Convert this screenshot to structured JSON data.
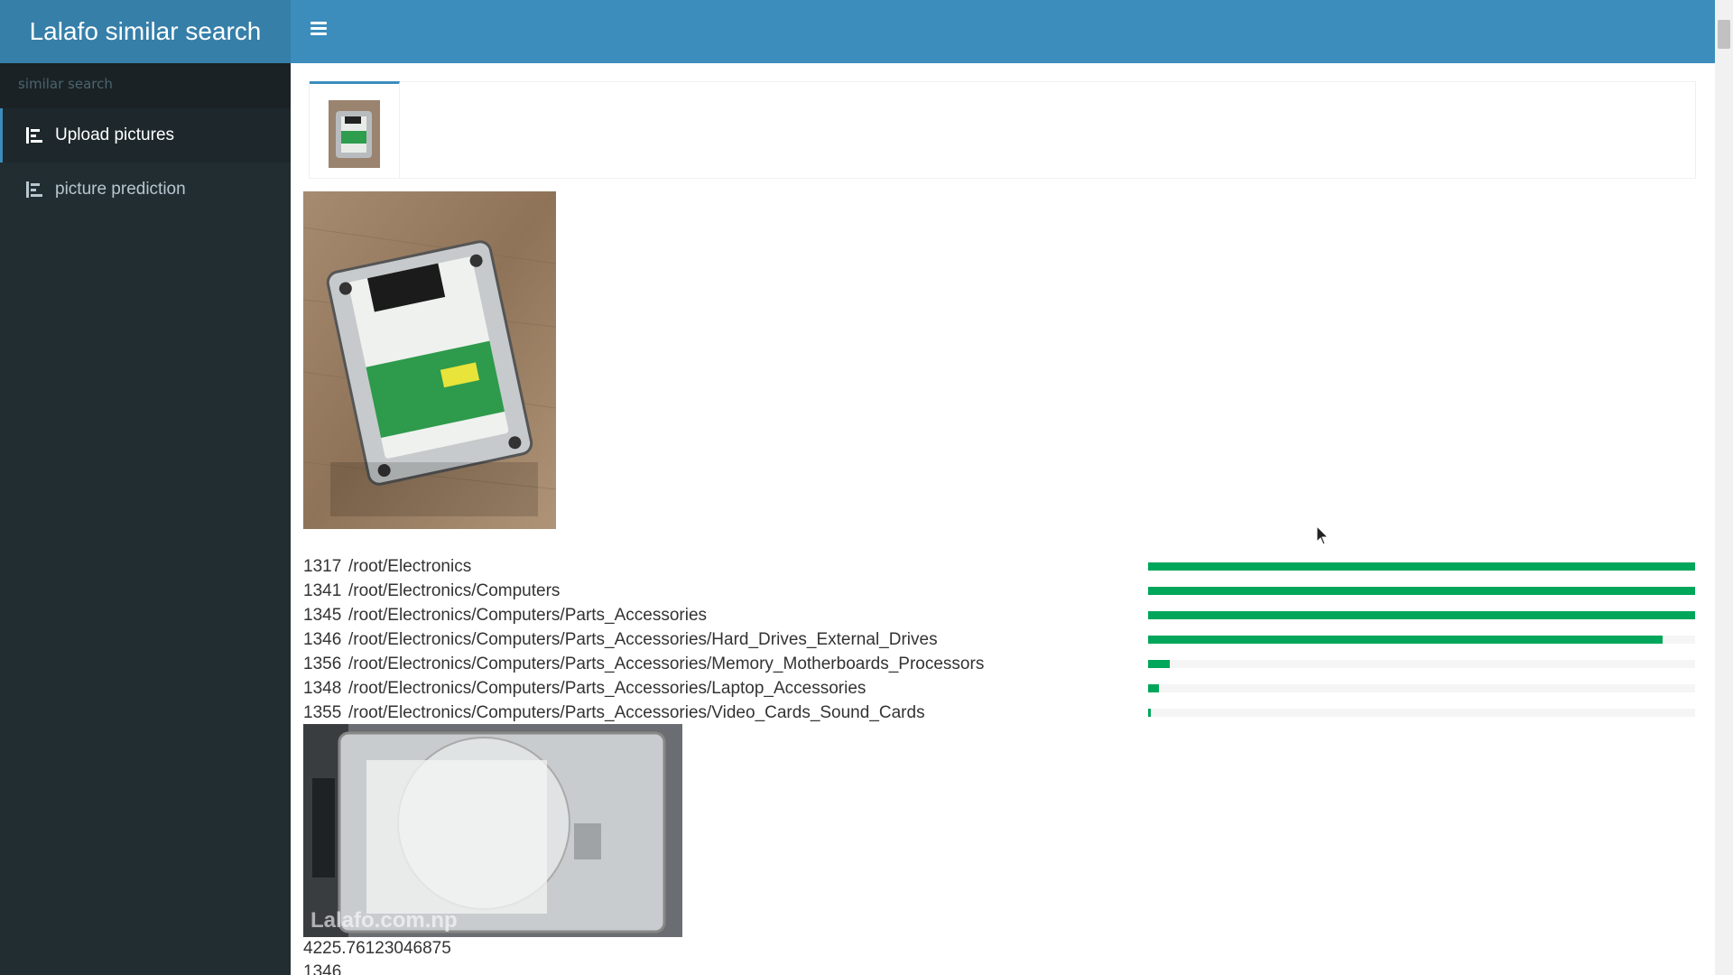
{
  "app": {
    "title": "Lalafo similar search"
  },
  "sidebar": {
    "header": "similar search",
    "items": [
      {
        "label": "Upload pictures",
        "icon": "bar-chart-icon",
        "active": true
      },
      {
        "label": "picture prediction",
        "icon": "bar-chart-icon",
        "active": false
      }
    ]
  },
  "colors": {
    "sidebar_bg": "#222d32",
    "header_bg": "#3c8dbc",
    "logo_bg": "#367fa9",
    "bar_green": "#00a65a"
  },
  "results": [
    {
      "id": "1317",
      "path": "/root/Electronics",
      "probability": 1.0
    },
    {
      "id": "1341",
      "path": "/root/Electronics/Computers",
      "probability": 1.0
    },
    {
      "id": "1345",
      "path": "/root/Electronics/Computers/Parts_Accessories",
      "probability": 1.0
    },
    {
      "id": "1346",
      "path": "/root/Electronics/Computers/Parts_Accessories/Hard_Drives_External_Drives",
      "probability": 0.94
    },
    {
      "id": "1356",
      "path": "/root/Electronics/Computers/Parts_Accessories/Memory_Motherboards_Processors",
      "probability": 0.04
    },
    {
      "id": "1348",
      "path": "/root/Electronics/Computers/Parts_Accessories/Laptop_Accessories",
      "probability": 0.02
    },
    {
      "id": "1355",
      "path": "/root/Electronics/Computers/Parts_Accessories/Video_Cards_Sound_Cards",
      "probability": 0.005
    }
  ],
  "similar": {
    "watermark": "Lalafo.com.np",
    "distance": "4225.76123046875",
    "category_id": "1346"
  }
}
